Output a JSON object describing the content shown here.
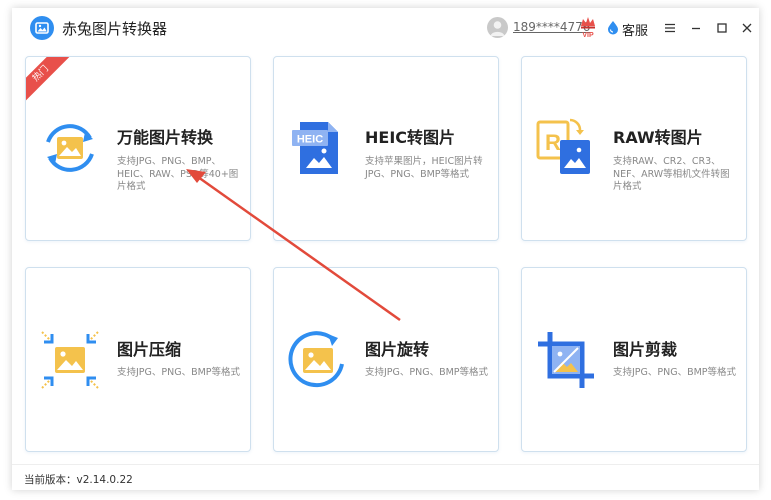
{
  "app": {
    "title": "赤兔图片转换器",
    "logo_icon": "picture-icon",
    "accent_color": "#2f8ef0"
  },
  "header": {
    "phone": "189****4776",
    "vip_label": "VIP",
    "service_label": "客服",
    "icons": [
      "user-avatar-icon",
      "vip-crown-icon",
      "customer-service-icon",
      "menu-icon",
      "minimize-icon",
      "maximize-icon",
      "close-icon"
    ]
  },
  "cards": [
    {
      "id": "all-convert",
      "title": "万能图片转换",
      "description": "支持JPG、PNG、BMP、HEIC、RAW、PSD等40+图片格式",
      "badge": "热门",
      "icon": "convert-picture-icon"
    },
    {
      "id": "heic",
      "title": "HEIC转图片",
      "description": "支持苹果图片，HEIC图片转JPG、PNG、BMP等格式",
      "icon_text": "HEIC",
      "icon": "heic-file-icon"
    },
    {
      "id": "raw",
      "title": "RAW转图片",
      "description": "支持RAW、CR2、CR3、NEF、ARW等相机文件转图片格式",
      "icon_text": "R",
      "icon": "raw-file-icon"
    },
    {
      "id": "compress",
      "title": "图片压缩",
      "description": "支持JPG、PNG、BMP等格式",
      "icon": "compress-picture-icon"
    },
    {
      "id": "rotate",
      "title": "图片旋转",
      "description": "支持JPG、PNG、BMP等格式",
      "icon": "rotate-picture-icon"
    },
    {
      "id": "crop",
      "title": "图片剪裁",
      "description": "支持JPG、PNG、BMP等格式",
      "icon": "crop-picture-icon"
    }
  ],
  "footer": {
    "version_label": "当前版本：v2.14.0.22"
  },
  "colors": {
    "image_yellow": "#f4c24c",
    "primary_blue": "#2f8ef0",
    "hot_red": "#e8504a",
    "arrow_red": "#e24a3b"
  }
}
